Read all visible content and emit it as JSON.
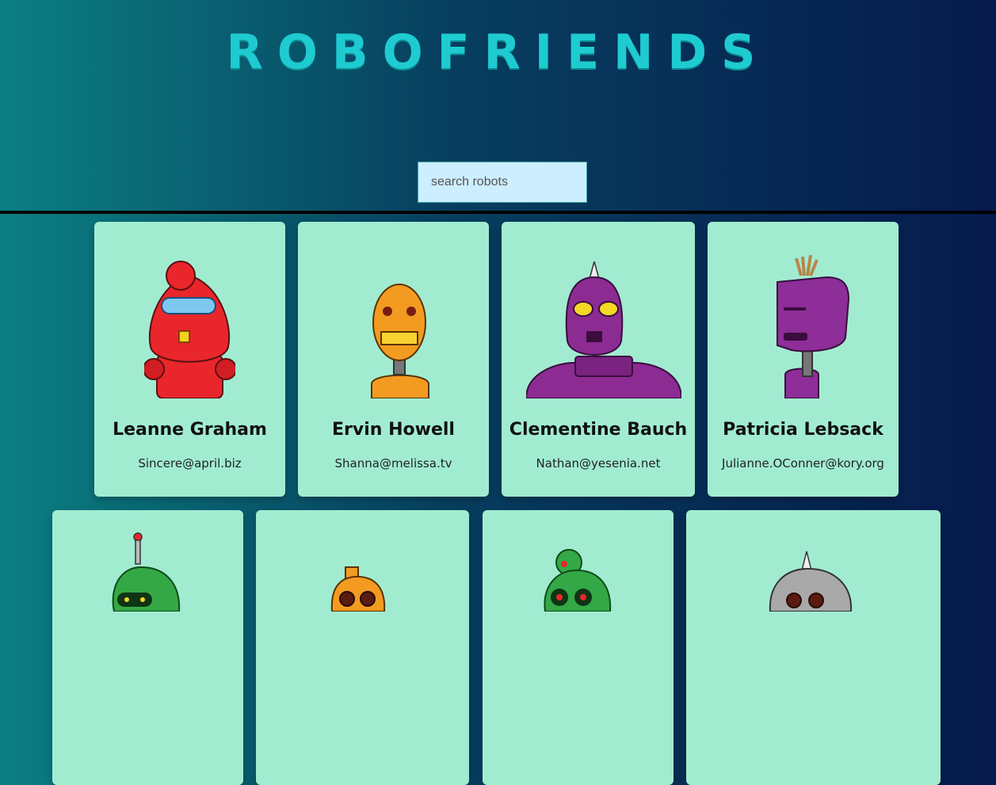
{
  "app": {
    "title": "RoboFriends"
  },
  "search": {
    "placeholder": "search robots"
  },
  "robots": [
    {
      "name": "Leanne Graham",
      "email": "Sincere@april.biz",
      "color": "#e9262b"
    },
    {
      "name": "Ervin Howell",
      "email": "Shanna@melissa.tv",
      "color": "#f39b21"
    },
    {
      "name": "Clementine Bauch",
      "email": "Nathan@yesenia.net",
      "color": "#8c2c93"
    },
    {
      "name": "Patricia Lebsack",
      "email": "Julianne.OConner@kory.org",
      "color": "#8e2e98"
    },
    {
      "name": "",
      "email": "",
      "color": "#34a846"
    },
    {
      "name": "",
      "email": "",
      "color": "#f39b21"
    },
    {
      "name": "",
      "email": "",
      "color": "#34a846"
    },
    {
      "name": "",
      "email": "",
      "color": "#a9a9a9"
    }
  ]
}
